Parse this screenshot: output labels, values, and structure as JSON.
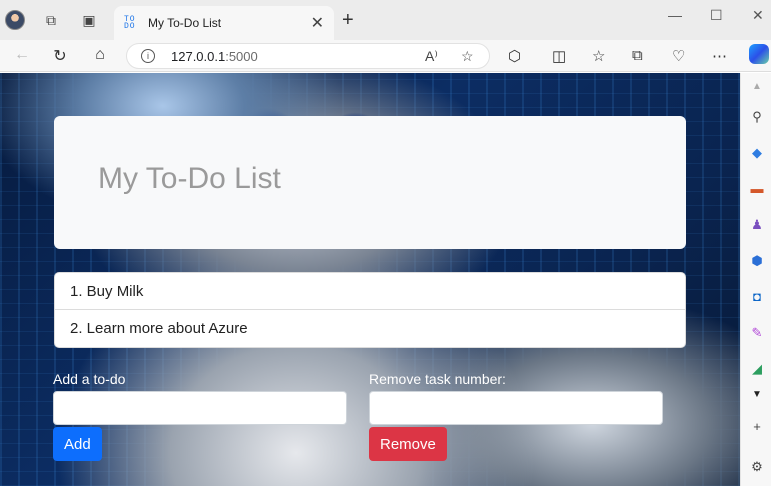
{
  "browser": {
    "tab_title": "My To-Do List",
    "tab_favicon": "TO DO",
    "url_host": "127.0.0.1",
    "url_port": ":5000"
  },
  "page": {
    "heading": "My To-Do List",
    "todos": [
      "1. Buy Milk",
      "2. Learn more about Azure"
    ],
    "add_label": "Add a to-do",
    "add_value": "",
    "add_button": "Add",
    "remove_label": "Remove task number:",
    "remove_value": "",
    "remove_button": "Remove"
  },
  "colors": {
    "add_button": "#0d6efd",
    "remove_button": "#dc3545"
  }
}
